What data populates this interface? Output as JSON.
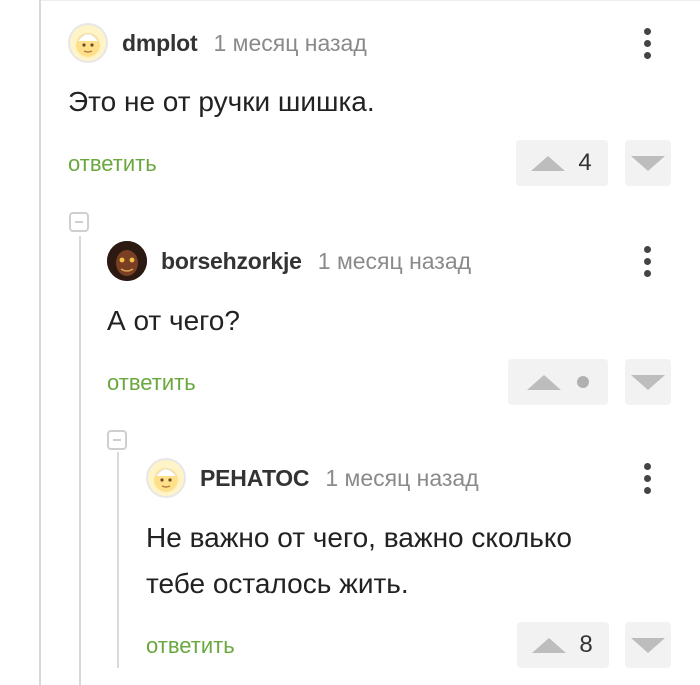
{
  "comments": [
    {
      "author": "dmplot",
      "time": "1 месяц назад",
      "text_lines": [
        "Это не от ручки шишка."
      ],
      "reply_label": "ответить",
      "score": "4",
      "avatar_icon": "cartoon-face-avatar"
    },
    {
      "author": "borsehzorkje",
      "time": "1 месяц назад",
      "text_lines": [
        "А от чего?"
      ],
      "reply_label": "ответить",
      "score": "",
      "avatar_icon": "photo-avatar"
    },
    {
      "author": "РЕНАТОС",
      "time": "1 месяц назад",
      "text_lines": [
        "Не важно от чего, важно сколько",
        "тебе осталось жить."
      ],
      "reply_label": "ответить",
      "score": "8",
      "avatar_icon": "cartoon-face-avatar"
    }
  ],
  "colors": {
    "reply_link": "#6aa83f",
    "vote_bg": "#f2f2f2",
    "vote_arrow": "#bdbdbd",
    "thread_line": "#d9d9d9"
  }
}
